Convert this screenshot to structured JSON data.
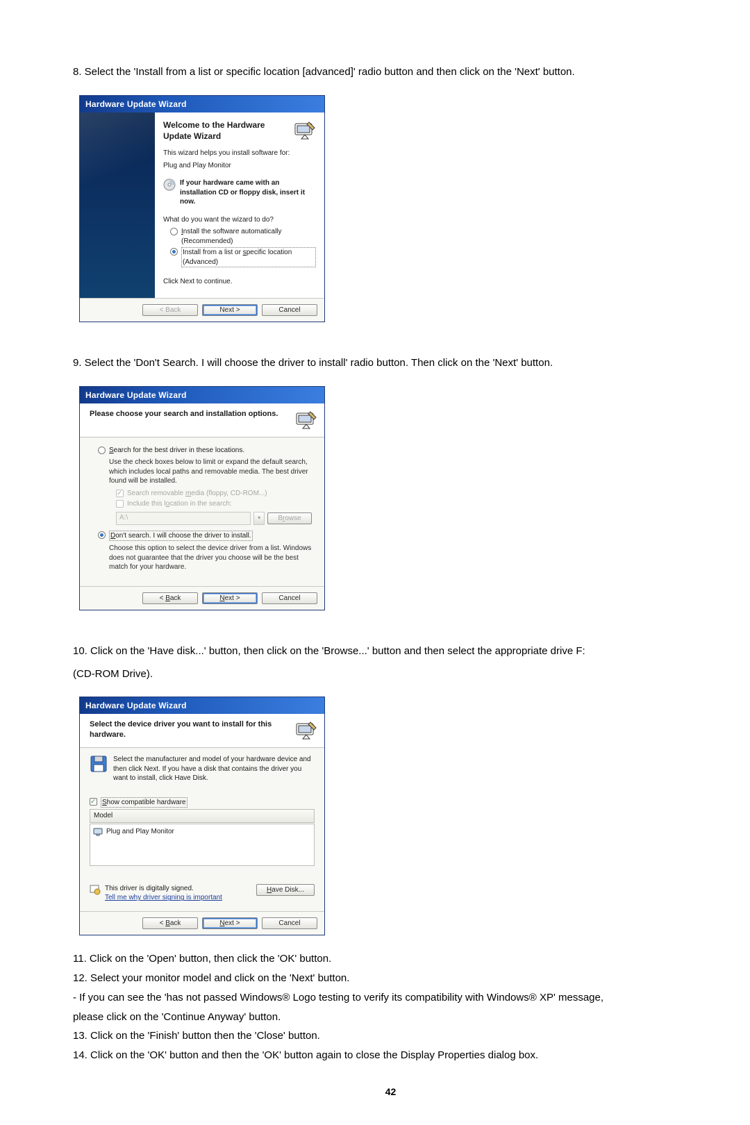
{
  "instructions": {
    "step8": "8. Select the 'Install from a list or specific location [advanced]' radio button and then click on the 'Next' button.",
    "step9": "9. Select the 'Don't Search. I will choose the driver to install' radio button. Then click on the 'Next' button.",
    "step10_a": "10. Click on the 'Have disk...' button, then click on the 'Browse...' button and then select the appropriate drive F:",
    "step10_b": "(CD-ROM Drive).",
    "step11": "11. Click on the 'Open' button, then click the 'OK' button.",
    "step12": "12. Select your monitor model and click on the 'Next' button.",
    "step12_note": "- If you can see the 'has not passed Windows® Logo testing to verify its compatibility with Windows® XP' message,",
    "step12_note2": "please click on the 'Continue Anyway' button.",
    "step13": "13. Click on the 'Finish' button then the 'Close' button.",
    "step14": "14. Click on the 'OK' button and then the 'OK' button again to close the Display Properties dialog box."
  },
  "wizard_common": {
    "title": "Hardware Update Wizard",
    "back": "< Back",
    "next": "Next >",
    "cancel": "Cancel",
    "browse": "Browse"
  },
  "wiz1": {
    "heading": "Welcome to the Hardware Update Wizard",
    "line1": "This wizard helps you install software for:",
    "device": "Plug and Play Monitor",
    "cd_bold": "If your hardware came with an installation CD or floppy disk, insert it now.",
    "prompt": "What do you want the wizard to do?",
    "opt_auto": "Install the software automatically (Recommended)",
    "opt_list": "Install from a list or specific location (Advanced)",
    "click_next": "Click Next to continue."
  },
  "wiz2": {
    "subtitle": "Please choose your search and installation options.",
    "opt_search": "Search for the best driver in these locations.",
    "search_desc": "Use the check boxes below to limit or expand the default search, which includes local paths and removable media. The best driver found will be installed.",
    "chk_media": "Search removable media (floppy, CD-ROM...)",
    "chk_include": "Include this location in the search:",
    "path_value": "A:\\",
    "opt_dont": "Don't search. I will choose the driver to install.",
    "dont_desc": "Choose this option to select the device driver from a list. Windows does not guarantee that the driver you choose will be the best match for your hardware."
  },
  "wiz3": {
    "subtitle": "Select the device driver you want to install for this hardware.",
    "desc": "Select the manufacturer and model of your hardware device and then click Next. If you have a disk that contains the driver you want to install, click Have Disk.",
    "chk_compat": "Show compatible hardware",
    "col_model": "Model",
    "item1": "Plug and Play Monitor",
    "signed": "This driver is digitally signed.",
    "tell_me": "Tell me why driver signing is important",
    "have_disk": "Have Disk..."
  },
  "page_number": "42"
}
